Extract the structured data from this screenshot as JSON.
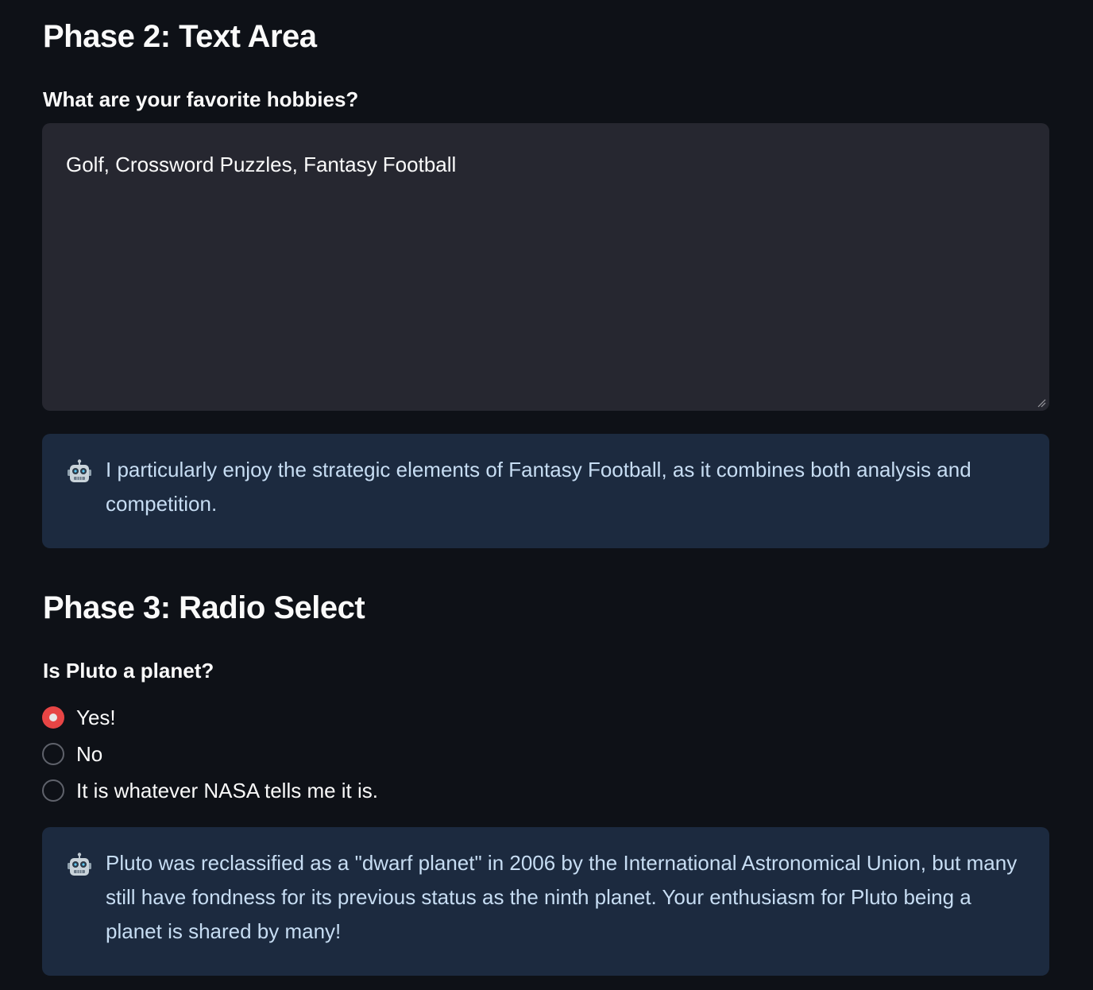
{
  "phase2": {
    "title": "Phase 2: Text Area",
    "question": "What are your favorite hobbies?",
    "textarea_value": "Golf, Crossword Puzzles, Fantasy Football",
    "response": "I particularly enjoy the strategic elements of Fantasy Football, as it combines both analysis and competition."
  },
  "phase3": {
    "title": "Phase 3: Radio Select",
    "question": "Is Pluto a planet?",
    "options": [
      {
        "label": "Yes!",
        "selected": true
      },
      {
        "label": "No",
        "selected": false
      },
      {
        "label": "It is whatever NASA tells me it is.",
        "selected": false
      }
    ],
    "response": "Pluto was reclassified as a \"dwarf planet\" in 2006 by the International Astronomical Union, but many still have fondness for its previous status as the ninth planet. Your enthusiasm for Pluto being a planet is shared by many!"
  },
  "colors": {
    "background": "#0e1117",
    "input_bg": "#262730",
    "chat_bg": "#1c2a3f",
    "accent": "#ff4b4b",
    "chat_text": "#c7ddf3"
  },
  "icons": {
    "assistant_avatar": "robot-icon",
    "textarea_resize": "resize-handle-icon"
  }
}
